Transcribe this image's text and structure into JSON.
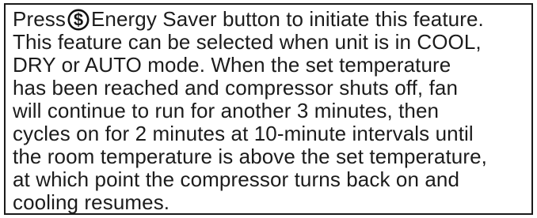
{
  "instruction": {
    "line1_before_icon": "Press",
    "icon": "dollar-sign-icon",
    "icon_glyph": "$",
    "line1_after_icon": "Energy Saver button to initiate this feature.",
    "lines": [
      "This feature can be selected when unit is in COOL,",
      "DRY or AUTO mode. When the set temperature",
      "has been reached and compressor shuts off, fan",
      "will continue to run for another 3 minutes, then",
      "cycles on for 2 minutes at 10-minute intervals until",
      "the room temperature is above the set temperature,",
      "at which point the compressor turns back on and",
      "cooling resumes."
    ]
  }
}
